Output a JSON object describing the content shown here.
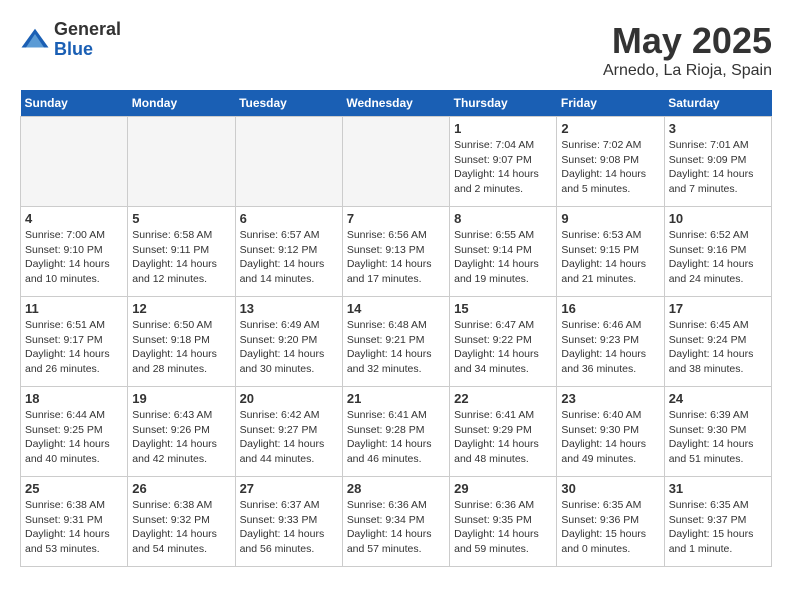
{
  "logo": {
    "general": "General",
    "blue": "Blue"
  },
  "title": {
    "month": "May 2025",
    "location": "Arnedo, La Rioja, Spain"
  },
  "weekdays": [
    "Sunday",
    "Monday",
    "Tuesday",
    "Wednesday",
    "Thursday",
    "Friday",
    "Saturday"
  ],
  "weeks": [
    [
      {
        "day": "",
        "info": ""
      },
      {
        "day": "",
        "info": ""
      },
      {
        "day": "",
        "info": ""
      },
      {
        "day": "",
        "info": ""
      },
      {
        "day": "1",
        "info": "Sunrise: 7:04 AM\nSunset: 9:07 PM\nDaylight: 14 hours\nand 2 minutes."
      },
      {
        "day": "2",
        "info": "Sunrise: 7:02 AM\nSunset: 9:08 PM\nDaylight: 14 hours\nand 5 minutes."
      },
      {
        "day": "3",
        "info": "Sunrise: 7:01 AM\nSunset: 9:09 PM\nDaylight: 14 hours\nand 7 minutes."
      }
    ],
    [
      {
        "day": "4",
        "info": "Sunrise: 7:00 AM\nSunset: 9:10 PM\nDaylight: 14 hours\nand 10 minutes."
      },
      {
        "day": "5",
        "info": "Sunrise: 6:58 AM\nSunset: 9:11 PM\nDaylight: 14 hours\nand 12 minutes."
      },
      {
        "day": "6",
        "info": "Sunrise: 6:57 AM\nSunset: 9:12 PM\nDaylight: 14 hours\nand 14 minutes."
      },
      {
        "day": "7",
        "info": "Sunrise: 6:56 AM\nSunset: 9:13 PM\nDaylight: 14 hours\nand 17 minutes."
      },
      {
        "day": "8",
        "info": "Sunrise: 6:55 AM\nSunset: 9:14 PM\nDaylight: 14 hours\nand 19 minutes."
      },
      {
        "day": "9",
        "info": "Sunrise: 6:53 AM\nSunset: 9:15 PM\nDaylight: 14 hours\nand 21 minutes."
      },
      {
        "day": "10",
        "info": "Sunrise: 6:52 AM\nSunset: 9:16 PM\nDaylight: 14 hours\nand 24 minutes."
      }
    ],
    [
      {
        "day": "11",
        "info": "Sunrise: 6:51 AM\nSunset: 9:17 PM\nDaylight: 14 hours\nand 26 minutes."
      },
      {
        "day": "12",
        "info": "Sunrise: 6:50 AM\nSunset: 9:18 PM\nDaylight: 14 hours\nand 28 minutes."
      },
      {
        "day": "13",
        "info": "Sunrise: 6:49 AM\nSunset: 9:20 PM\nDaylight: 14 hours\nand 30 minutes."
      },
      {
        "day": "14",
        "info": "Sunrise: 6:48 AM\nSunset: 9:21 PM\nDaylight: 14 hours\nand 32 minutes."
      },
      {
        "day": "15",
        "info": "Sunrise: 6:47 AM\nSunset: 9:22 PM\nDaylight: 14 hours\nand 34 minutes."
      },
      {
        "day": "16",
        "info": "Sunrise: 6:46 AM\nSunset: 9:23 PM\nDaylight: 14 hours\nand 36 minutes."
      },
      {
        "day": "17",
        "info": "Sunrise: 6:45 AM\nSunset: 9:24 PM\nDaylight: 14 hours\nand 38 minutes."
      }
    ],
    [
      {
        "day": "18",
        "info": "Sunrise: 6:44 AM\nSunset: 9:25 PM\nDaylight: 14 hours\nand 40 minutes."
      },
      {
        "day": "19",
        "info": "Sunrise: 6:43 AM\nSunset: 9:26 PM\nDaylight: 14 hours\nand 42 minutes."
      },
      {
        "day": "20",
        "info": "Sunrise: 6:42 AM\nSunset: 9:27 PM\nDaylight: 14 hours\nand 44 minutes."
      },
      {
        "day": "21",
        "info": "Sunrise: 6:41 AM\nSunset: 9:28 PM\nDaylight: 14 hours\nand 46 minutes."
      },
      {
        "day": "22",
        "info": "Sunrise: 6:41 AM\nSunset: 9:29 PM\nDaylight: 14 hours\nand 48 minutes."
      },
      {
        "day": "23",
        "info": "Sunrise: 6:40 AM\nSunset: 9:30 PM\nDaylight: 14 hours\nand 49 minutes."
      },
      {
        "day": "24",
        "info": "Sunrise: 6:39 AM\nSunset: 9:30 PM\nDaylight: 14 hours\nand 51 minutes."
      }
    ],
    [
      {
        "day": "25",
        "info": "Sunrise: 6:38 AM\nSunset: 9:31 PM\nDaylight: 14 hours\nand 53 minutes."
      },
      {
        "day": "26",
        "info": "Sunrise: 6:38 AM\nSunset: 9:32 PM\nDaylight: 14 hours\nand 54 minutes."
      },
      {
        "day": "27",
        "info": "Sunrise: 6:37 AM\nSunset: 9:33 PM\nDaylight: 14 hours\nand 56 minutes."
      },
      {
        "day": "28",
        "info": "Sunrise: 6:36 AM\nSunset: 9:34 PM\nDaylight: 14 hours\nand 57 minutes."
      },
      {
        "day": "29",
        "info": "Sunrise: 6:36 AM\nSunset: 9:35 PM\nDaylight: 14 hours\nand 59 minutes."
      },
      {
        "day": "30",
        "info": "Sunrise: 6:35 AM\nSunset: 9:36 PM\nDaylight: 15 hours\nand 0 minutes."
      },
      {
        "day": "31",
        "info": "Sunrise: 6:35 AM\nSunset: 9:37 PM\nDaylight: 15 hours\nand 1 minute."
      }
    ]
  ]
}
